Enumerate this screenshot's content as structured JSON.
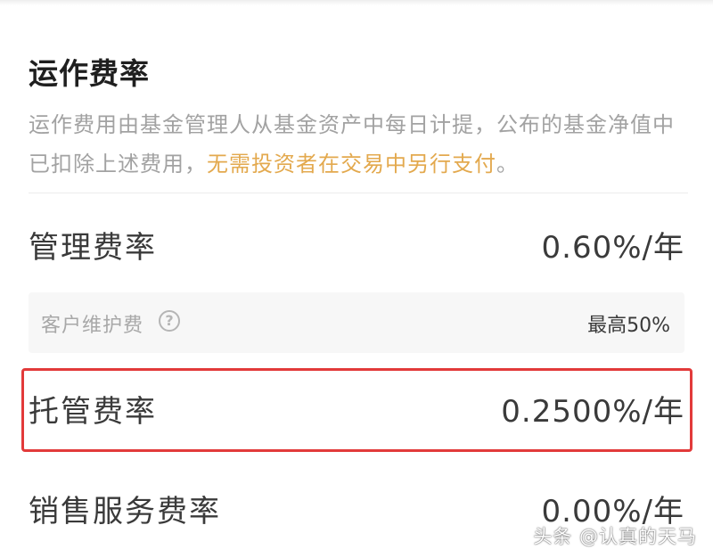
{
  "section": {
    "title": "运作费率",
    "description_plain": "运作费用由基金管理人从基金资产中每日计提，公布的基金净值中已扣除上述费用，",
    "description_highlight": "无需投资者在交易中另行支付",
    "description_end": "。"
  },
  "fees": {
    "management": {
      "label": "管理费率",
      "value": "0.60%/年"
    },
    "client_maintenance": {
      "label": "客户维护费",
      "help_glyph": "?",
      "value": "最高50%"
    },
    "custody": {
      "label": "托管费率",
      "value": "0.2500%/年"
    },
    "sales_service": {
      "label": "销售服务费率",
      "value": "0.00%/年"
    }
  },
  "colors": {
    "highlight": "#e3a94e",
    "emphasis_border": "#e23a3a",
    "text_primary": "#3a3a3a",
    "text_secondary": "#a2a2a2"
  },
  "watermark": "头条 @认真的天马"
}
